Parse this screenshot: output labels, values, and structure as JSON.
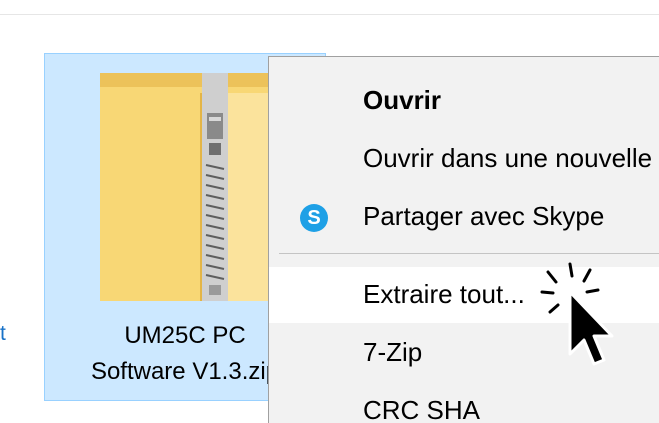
{
  "left_partial_text": "t",
  "file": {
    "label_line1": "UM25C PC",
    "label_line2": "Software V1.3.zip"
  },
  "menu": {
    "items": [
      {
        "label": "Ouvrir"
      },
      {
        "label": "Ouvrir dans une nouvelle fenêtre"
      },
      {
        "label": "Partager avec Skype",
        "icon_glyph": "S"
      },
      {
        "label": "Extraire tout..."
      },
      {
        "label": "7-Zip"
      },
      {
        "label": "CRC SHA"
      }
    ]
  },
  "colors": {
    "selection_bg": "#cce8ff",
    "menu_bg": "#f2f2f2",
    "skype_blue": "#1ea0e6",
    "folder_yellow": "#f8d775"
  },
  "icons": {
    "file": "zip-folder-icon",
    "skype": "skype-icon",
    "cursor": "mouse-pointer-icon"
  }
}
